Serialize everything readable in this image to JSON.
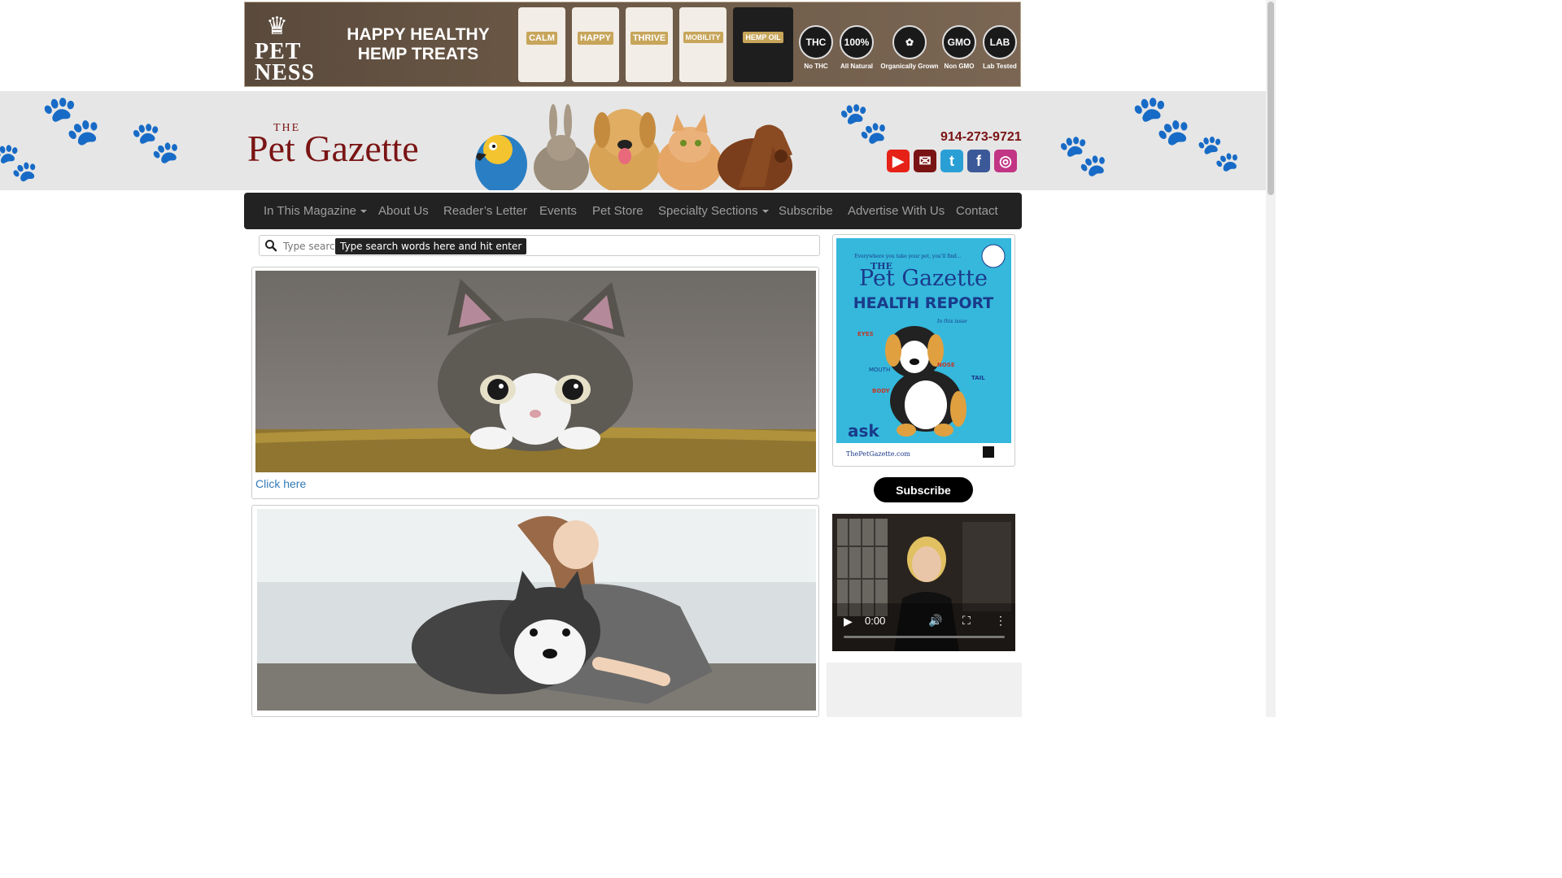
{
  "promo": {
    "brand_mark": "♛",
    "brand": "PET NESS",
    "headline": "HAPPY HEALTHY HEMP TREATS",
    "products": [
      "CALM",
      "HAPPY",
      "THRIVE",
      "MOBILITY",
      "HEMP OIL"
    ],
    "badges": [
      {
        "mark": "THC",
        "label": "No THC"
      },
      {
        "mark": "100%",
        "label": "All Natural"
      },
      {
        "mark": "✿",
        "label": "Organically Grown"
      },
      {
        "mark": "GMO",
        "label": "Non GMO"
      },
      {
        "mark": "LAB",
        "label": "Lab Tested"
      }
    ]
  },
  "header": {
    "logo_the": "THE",
    "logo_name": "Pet Gazette",
    "phone": "914-273-9721",
    "social": [
      {
        "icon": "youtube-icon",
        "glyph": "▶",
        "color": "#e62117"
      },
      {
        "icon": "email-icon",
        "glyph": "✉",
        "color": "#7a1414"
      },
      {
        "icon": "twitter-icon",
        "glyph": "t",
        "color": "#2a9fd6"
      },
      {
        "icon": "facebook-icon",
        "glyph": "f",
        "color": "#3b5998"
      },
      {
        "icon": "instagram-icon",
        "glyph": "◎",
        "color": "#c13584"
      }
    ]
  },
  "nav": {
    "items": [
      "In This Magazine",
      "About Us",
      "Reader’s Letter",
      "Events",
      "Pet Store",
      "Specialty Sections",
      "Subscribe",
      "Advertise With Us",
      "Contact"
    ]
  },
  "search": {
    "placeholder": "Type search words here and hit enter",
    "tooltip": "Type search words here and hit enter"
  },
  "main": {
    "card1_link": "Click here"
  },
  "sidebar": {
    "cover": {
      "tagline": "Everywhere you take your pet, you'll find...",
      "the": "THE",
      "title": "Pet Gazette",
      "subtitle": "HEALTH REPORT",
      "issue": "In this issue",
      "labels": [
        "EYES",
        "MOUTH",
        "BODY",
        "NOSE",
        "TAIL"
      ],
      "footer": "ThePetGazette.com",
      "ask": "ask"
    },
    "subscribe_label": "Subscribe",
    "video_time": "0:00"
  },
  "colors": {
    "brand": "#7a1414",
    "nav_bg": "#222222",
    "nav_text": "#9d9d9d",
    "link": "#337ab7",
    "cover_bg": "#35b8dc"
  }
}
